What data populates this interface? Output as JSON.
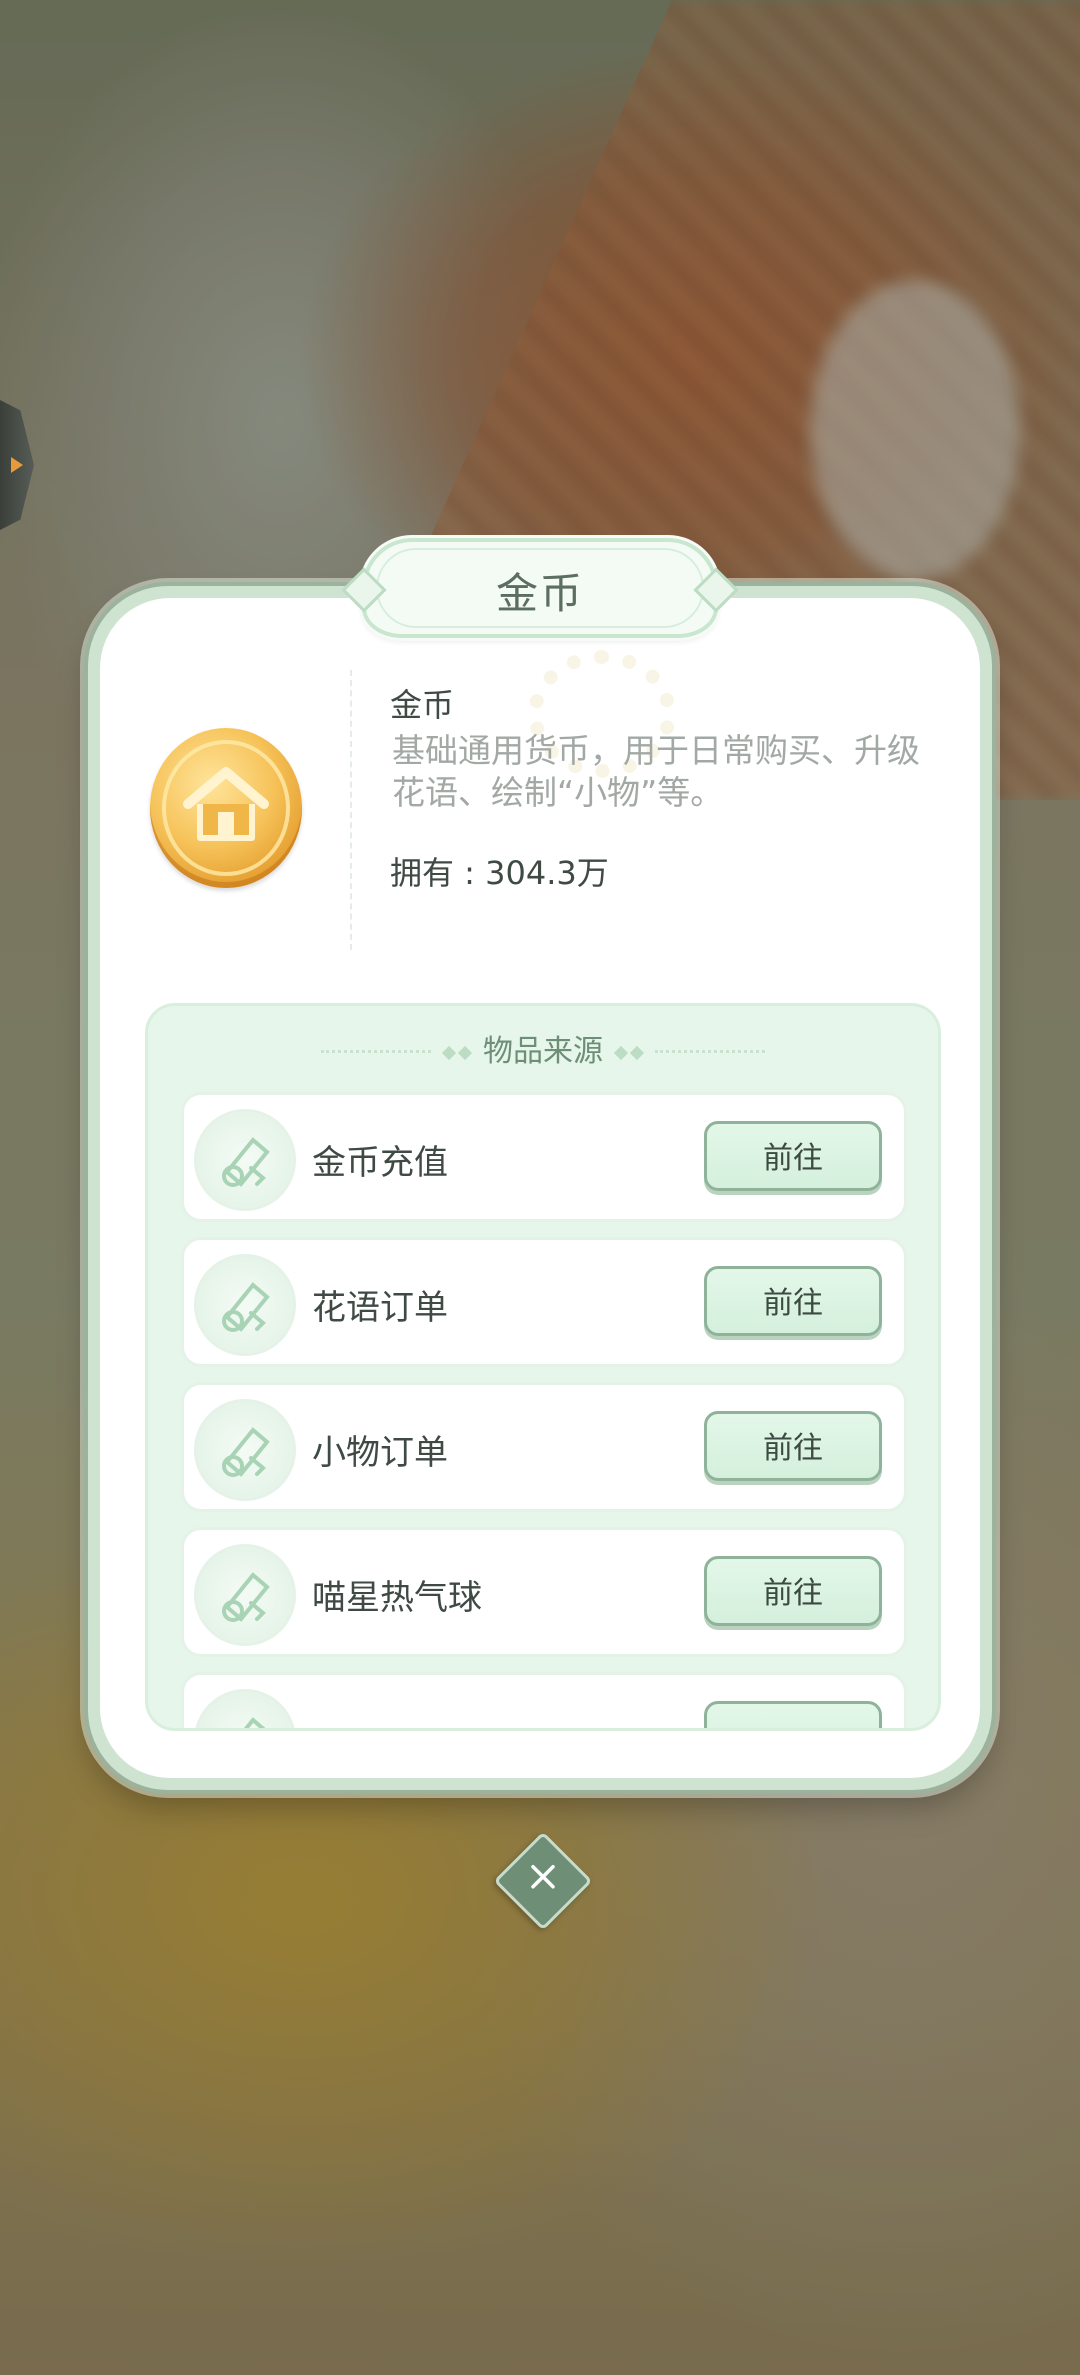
{
  "dialog": {
    "title": "金币",
    "item_name": "金币",
    "item_description": "基础通用货币，用于日常购买、升级花语、绘制“小物”等。",
    "owned_label": "拥有：",
    "owned_value": "304.3万",
    "owned_text": "拥有 : 304.3万"
  },
  "sources": {
    "title": "物品来源",
    "go_label": "前往",
    "rows": [
      {
        "label": "金币充值",
        "icon": "scroll-icon"
      },
      {
        "label": "花语订单",
        "icon": "scroll-icon"
      },
      {
        "label": "小物订单",
        "icon": "scroll-icon"
      },
      {
        "label": "喵星热气球",
        "icon": "scroll-icon"
      },
      {
        "label": "",
        "icon": "scroll-icon"
      }
    ]
  },
  "colors": {
    "accent_green": "#6e8f76",
    "button_bg": "#d4f0dc",
    "coin_gold": "#f6c35a"
  },
  "icons": {
    "coin": "house-coin-icon",
    "close": "close-icon",
    "side_tab": "arrow-right-icon"
  }
}
